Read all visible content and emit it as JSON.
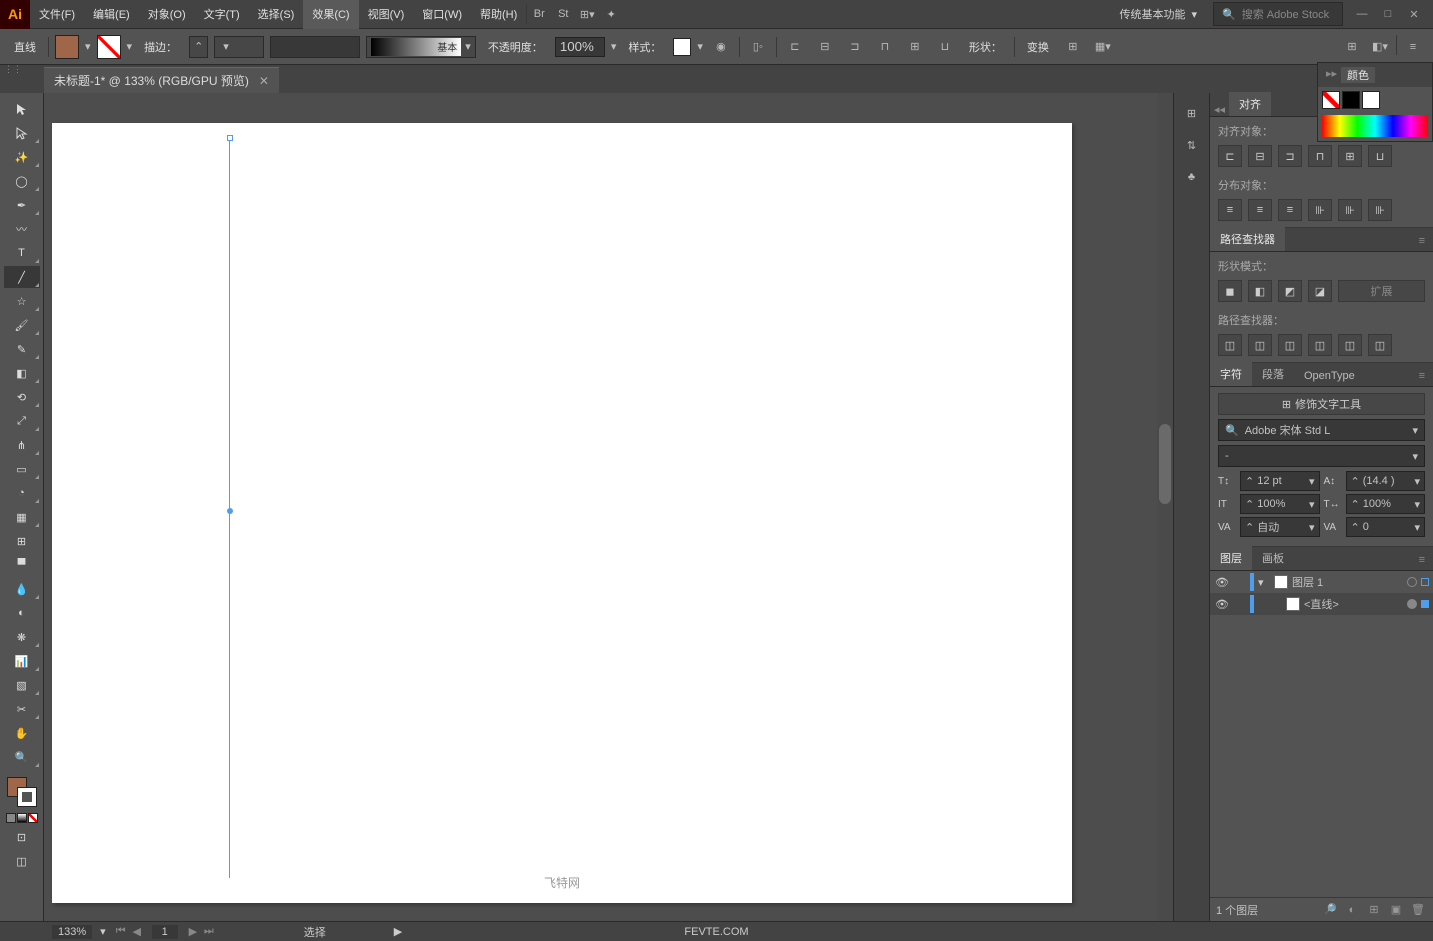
{
  "menubar": {
    "items": [
      "文件(F)",
      "编辑(E)",
      "对象(O)",
      "文字(T)",
      "选择(S)",
      "效果(C)",
      "视图(V)",
      "窗口(W)",
      "帮助(H)"
    ],
    "highlight_index": 5,
    "workspace": "传统基本功能",
    "search_placeholder": "搜索 Adobe Stock"
  },
  "controlbar": {
    "selection": "直线",
    "fill_color": "#a0664a",
    "stroke_label": "描边：",
    "profile_label": "基本",
    "opacity_label": "不透明度：",
    "opacity_value": "100%",
    "style_label": "样式：",
    "shape_label": "形状：",
    "transform_label": "变换"
  },
  "document": {
    "tab": "未标题-1* @ 133% (RGB/GPU 预览)"
  },
  "align_panel": {
    "tab": "对齐",
    "align_label": "对齐对象：",
    "distribute_label": "分布对象："
  },
  "pathfinder_panel": {
    "tab": "路径查找器",
    "shapemode_label": "形状模式：",
    "expand_label": "扩展",
    "pathfinder_label": "路径查找器："
  },
  "character_panel": {
    "tabs": [
      "字符",
      "段落",
      "OpenType"
    ],
    "touch_tool": "修饰文字工具",
    "font": "Adobe 宋体 Std L",
    "style": "-",
    "size": "12 pt",
    "leading": "(14.4 )",
    "vscale": "100%",
    "hscale": "100%",
    "kerning": "自动",
    "tracking": "0"
  },
  "layers_panel": {
    "tabs": [
      "图层",
      "画板"
    ],
    "items": [
      {
        "name": "图层 1",
        "expanded": true
      },
      {
        "name": "<直线>",
        "selected": true
      }
    ],
    "footer": "1 个图层"
  },
  "color_flyout": {
    "tab": "颜色"
  },
  "status": {
    "zoom": "133%",
    "page": "1",
    "mode": "选择",
    "watermark_cn": "飞特网",
    "watermark_en": "FEVTE.COM"
  }
}
